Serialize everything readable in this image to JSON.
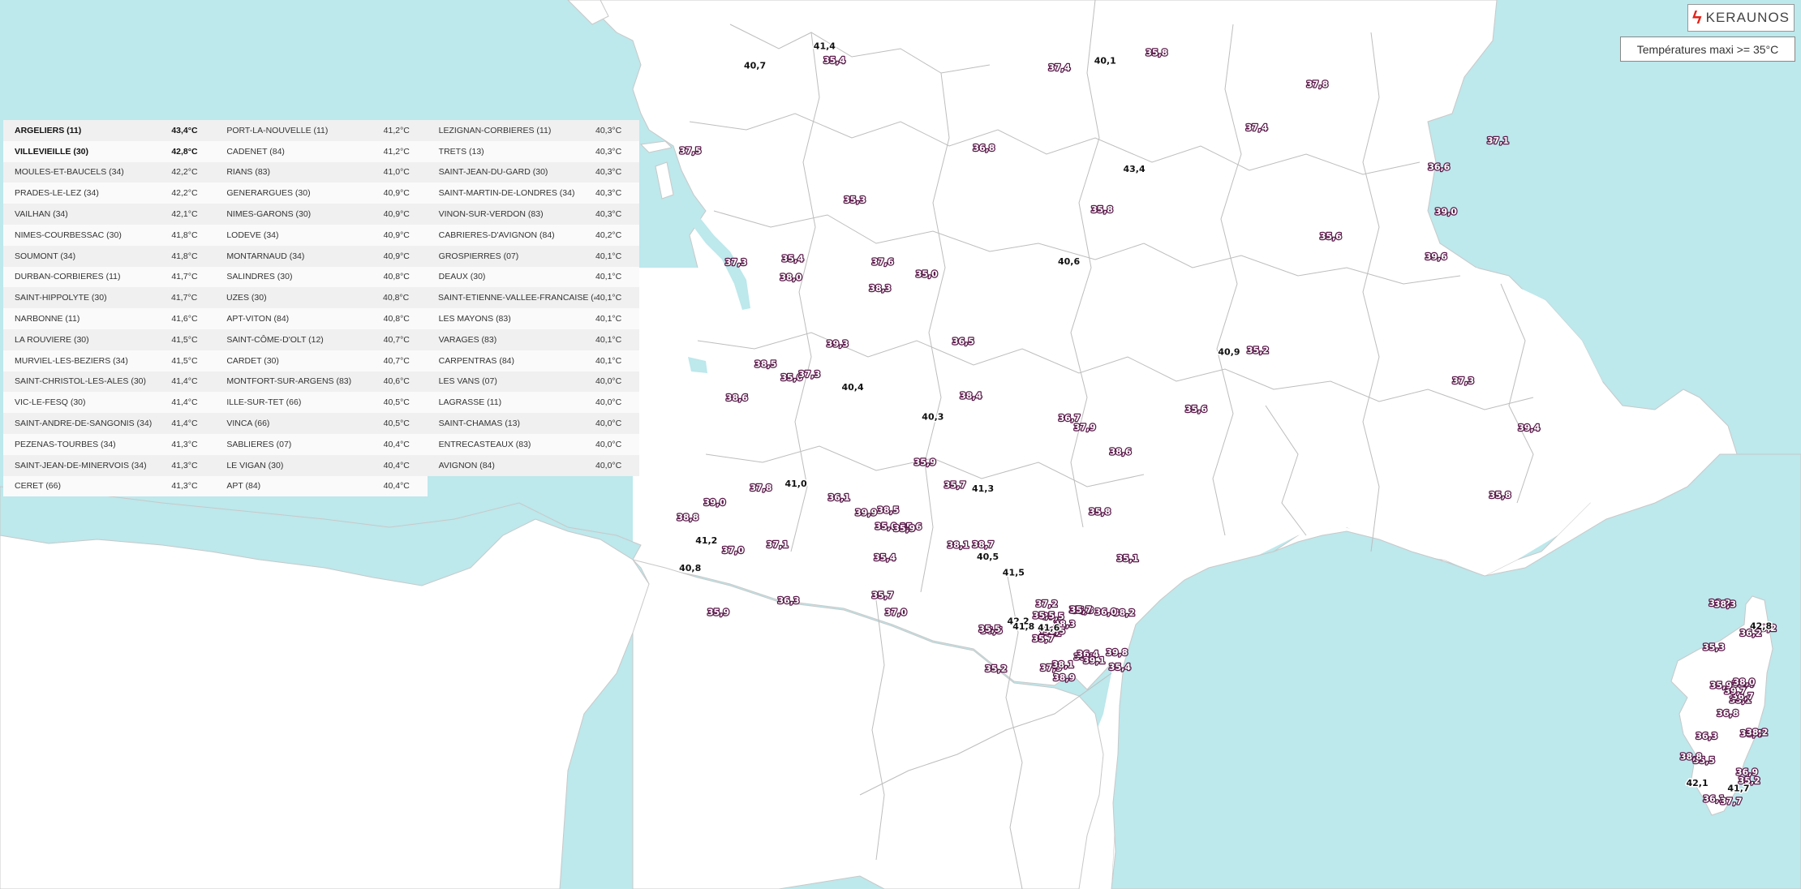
{
  "header": {
    "logo_text": "KERAUNOS",
    "logo_icon": "lightning-bolt-icon",
    "legend_label": "Températures maxi >= 35°C"
  },
  "colors": {
    "sea": "#bde8ec",
    "land": "#ffffff",
    "border": "#b8b8b8",
    "label_fill": "#ffffff",
    "label_stroke": "#5a1a4a",
    "label_fill_dark": "#111111"
  },
  "ranking": {
    "columns": [
      [
        {
          "name": "ARGELIERS (11)",
          "value": "43,4°C",
          "bold": true
        },
        {
          "name": "VILLEVIEILLE (30)",
          "value": "42,8°C",
          "bold": true
        },
        {
          "name": "MOULES-ET-BAUCELS (34)",
          "value": "42,2°C"
        },
        {
          "name": "PRADES-LE-LEZ (34)",
          "value": "42,2°C"
        },
        {
          "name": "VAILHAN (34)",
          "value": "42,1°C"
        },
        {
          "name": "NIMES-COURBESSAC (30)",
          "value": "41,8°C"
        },
        {
          "name": "SOUMONT (34)",
          "value": "41,8°C"
        },
        {
          "name": "DURBAN-CORBIERES (11)",
          "value": "41,7°C"
        },
        {
          "name": "SAINT-HIPPOLYTE (30)",
          "value": "41,7°C"
        },
        {
          "name": "NARBONNE (11)",
          "value": "41,6°C"
        },
        {
          "name": "LA ROUVIERE (30)",
          "value": "41,5°C"
        },
        {
          "name": "MURVIEL-LES-BEZIERS (34)",
          "value": "41,5°C"
        },
        {
          "name": "SAINT-CHRISTOL-LES-ALES (30)",
          "value": "41,4°C"
        },
        {
          "name": "VIC-LE-FESQ (30)",
          "value": "41,4°C"
        },
        {
          "name": "SAINT-ANDRE-DE-SANGONIS (34)",
          "value": "41,4°C"
        },
        {
          "name": "PEZENAS-TOURBES (34)",
          "value": "41,3°C"
        },
        {
          "name": "SAINT-JEAN-DE-MINERVOIS (34)",
          "value": "41,3°C"
        },
        {
          "name": "CERET (66)",
          "value": "41,3°C"
        }
      ],
      [
        {
          "name": "PORT-LA-NOUVELLE (11)",
          "value": "41,2°C"
        },
        {
          "name": "CADENET (84)",
          "value": "41,2°C"
        },
        {
          "name": "RIANS (83)",
          "value": "41,0°C"
        },
        {
          "name": "GENERARGUES (30)",
          "value": "40,9°C"
        },
        {
          "name": "NIMES-GARONS (30)",
          "value": "40,9°C"
        },
        {
          "name": "LODEVE (34)",
          "value": "40,9°C"
        },
        {
          "name": "MONTARNAUD (34)",
          "value": "40,9°C"
        },
        {
          "name": "SALINDRES (30)",
          "value": "40,8°C"
        },
        {
          "name": "UZES (30)",
          "value": "40,8°C"
        },
        {
          "name": "APT-VITON (84)",
          "value": "40,8°C"
        },
        {
          "name": "SAINT-CÔME-D'OLT (12)",
          "value": "40,7°C"
        },
        {
          "name": "CARDET (30)",
          "value": "40,7°C"
        },
        {
          "name": "MONTFORT-SUR-ARGENS (83)",
          "value": "40,6°C"
        },
        {
          "name": "ILLE-SUR-TET (66)",
          "value": "40,5°C"
        },
        {
          "name": "VINCA (66)",
          "value": "40,5°C"
        },
        {
          "name": "SABLIERES (07)",
          "value": "40,4°C"
        },
        {
          "name": "LE VIGAN (30)",
          "value": "40,4°C"
        },
        {
          "name": "APT (84)",
          "value": "40,4°C"
        }
      ],
      [
        {
          "name": "LEZIGNAN-CORBIERES (11)",
          "value": "40,3°C"
        },
        {
          "name": "TRETS (13)",
          "value": "40,3°C"
        },
        {
          "name": "SAINT-JEAN-DU-GARD (30)",
          "value": "40,3°C"
        },
        {
          "name": "SAINT-MARTIN-DE-LONDRES (34)",
          "value": "40,3°C"
        },
        {
          "name": "VINON-SUR-VERDON (83)",
          "value": "40,3°C"
        },
        {
          "name": "CABRIERES-D'AVIGNON (84)",
          "value": "40,2°C"
        },
        {
          "name": "GROSPIERRES (07)",
          "value": "40,1°C"
        },
        {
          "name": "DEAUX (30)",
          "value": "40,1°C"
        },
        {
          "name": "SAINT-ETIENNE-VALLEE-FRANCAISE (48)",
          "value": "40,1°C"
        },
        {
          "name": "LES MAYONS (83)",
          "value": "40,1°C"
        },
        {
          "name": "VARAGES (83)",
          "value": "40,1°C"
        },
        {
          "name": "CARPENTRAS (84)",
          "value": "40,1°C"
        },
        {
          "name": "LES VANS (07)",
          "value": "40,0°C"
        },
        {
          "name": "LAGRASSE (11)",
          "value": "40,0°C"
        },
        {
          "name": "SAINT-CHAMAS (13)",
          "value": "40,0°C"
        },
        {
          "name": "ENTRECASTEAUX (83)",
          "value": "40,0°C"
        },
        {
          "name": "AVIGNON (84)",
          "value": "40,0°C"
        }
      ]
    ]
  },
  "map_labels": [
    "35,8",
    "35,6",
    "35,4",
    "35,2",
    "35,4",
    "35,0",
    "35,2",
    "35,6",
    "35,3",
    "35,1",
    "35,4",
    "35,8",
    "37,0",
    "38,2",
    "36,8",
    "37,4",
    "36,1",
    "35,0",
    "38,3",
    "35,5",
    "36,8",
    "37,8",
    "36,3",
    "37,5",
    "38,0",
    "35,6",
    "37,3",
    "38,5",
    "36,5",
    "38,4",
    "37,1",
    "36,7",
    "35,7",
    "38,2",
    "35,3",
    "37,8",
    "35,9",
    "37,6",
    "35,4",
    "38,2",
    "35,8",
    "38,4",
    "37,1",
    "35,5",
    "36,1",
    "37,5",
    "35,6",
    "35,9",
    "37,9",
    "36,7",
    "38,0",
    "37,3",
    "38,8",
    "36,4",
    "35,2",
    "38,3",
    "39,3",
    "39,0",
    "38,1",
    "39,2",
    "40,1",
    "40,3",
    "41,2",
    "42,2",
    "42,8",
    "41,4",
    "40,9",
    "39,9",
    "39,5",
    "38,8",
    "40,6",
    "41,3",
    "41,5",
    "41,8",
    "42,1",
    "40,7",
    "40,4",
    "40,8",
    "41,6",
    "41,7",
    "43,4",
    "41,0",
    "40,5",
    "39,8",
    "37,7",
    "36,6",
    "38,6",
    "37,2",
    "38,9",
    "36,9",
    "37,4",
    "39,4",
    "38,7",
    "39,1",
    "39,7",
    "39,6",
    "38,6",
    "37,0",
    "35,7",
    "36,2",
    "35,3",
    "36,5",
    "35,1",
    "35,5",
    "36,3",
    "37,6",
    "35,7",
    "38,1",
    "36,0",
    "35,9",
    "39,0",
    "38,5",
    "35,9",
    "35,7",
    "38,2",
    "37,3",
    "37,9",
    "35,8",
    "35,5",
    "38,3",
    "35,4"
  ]
}
